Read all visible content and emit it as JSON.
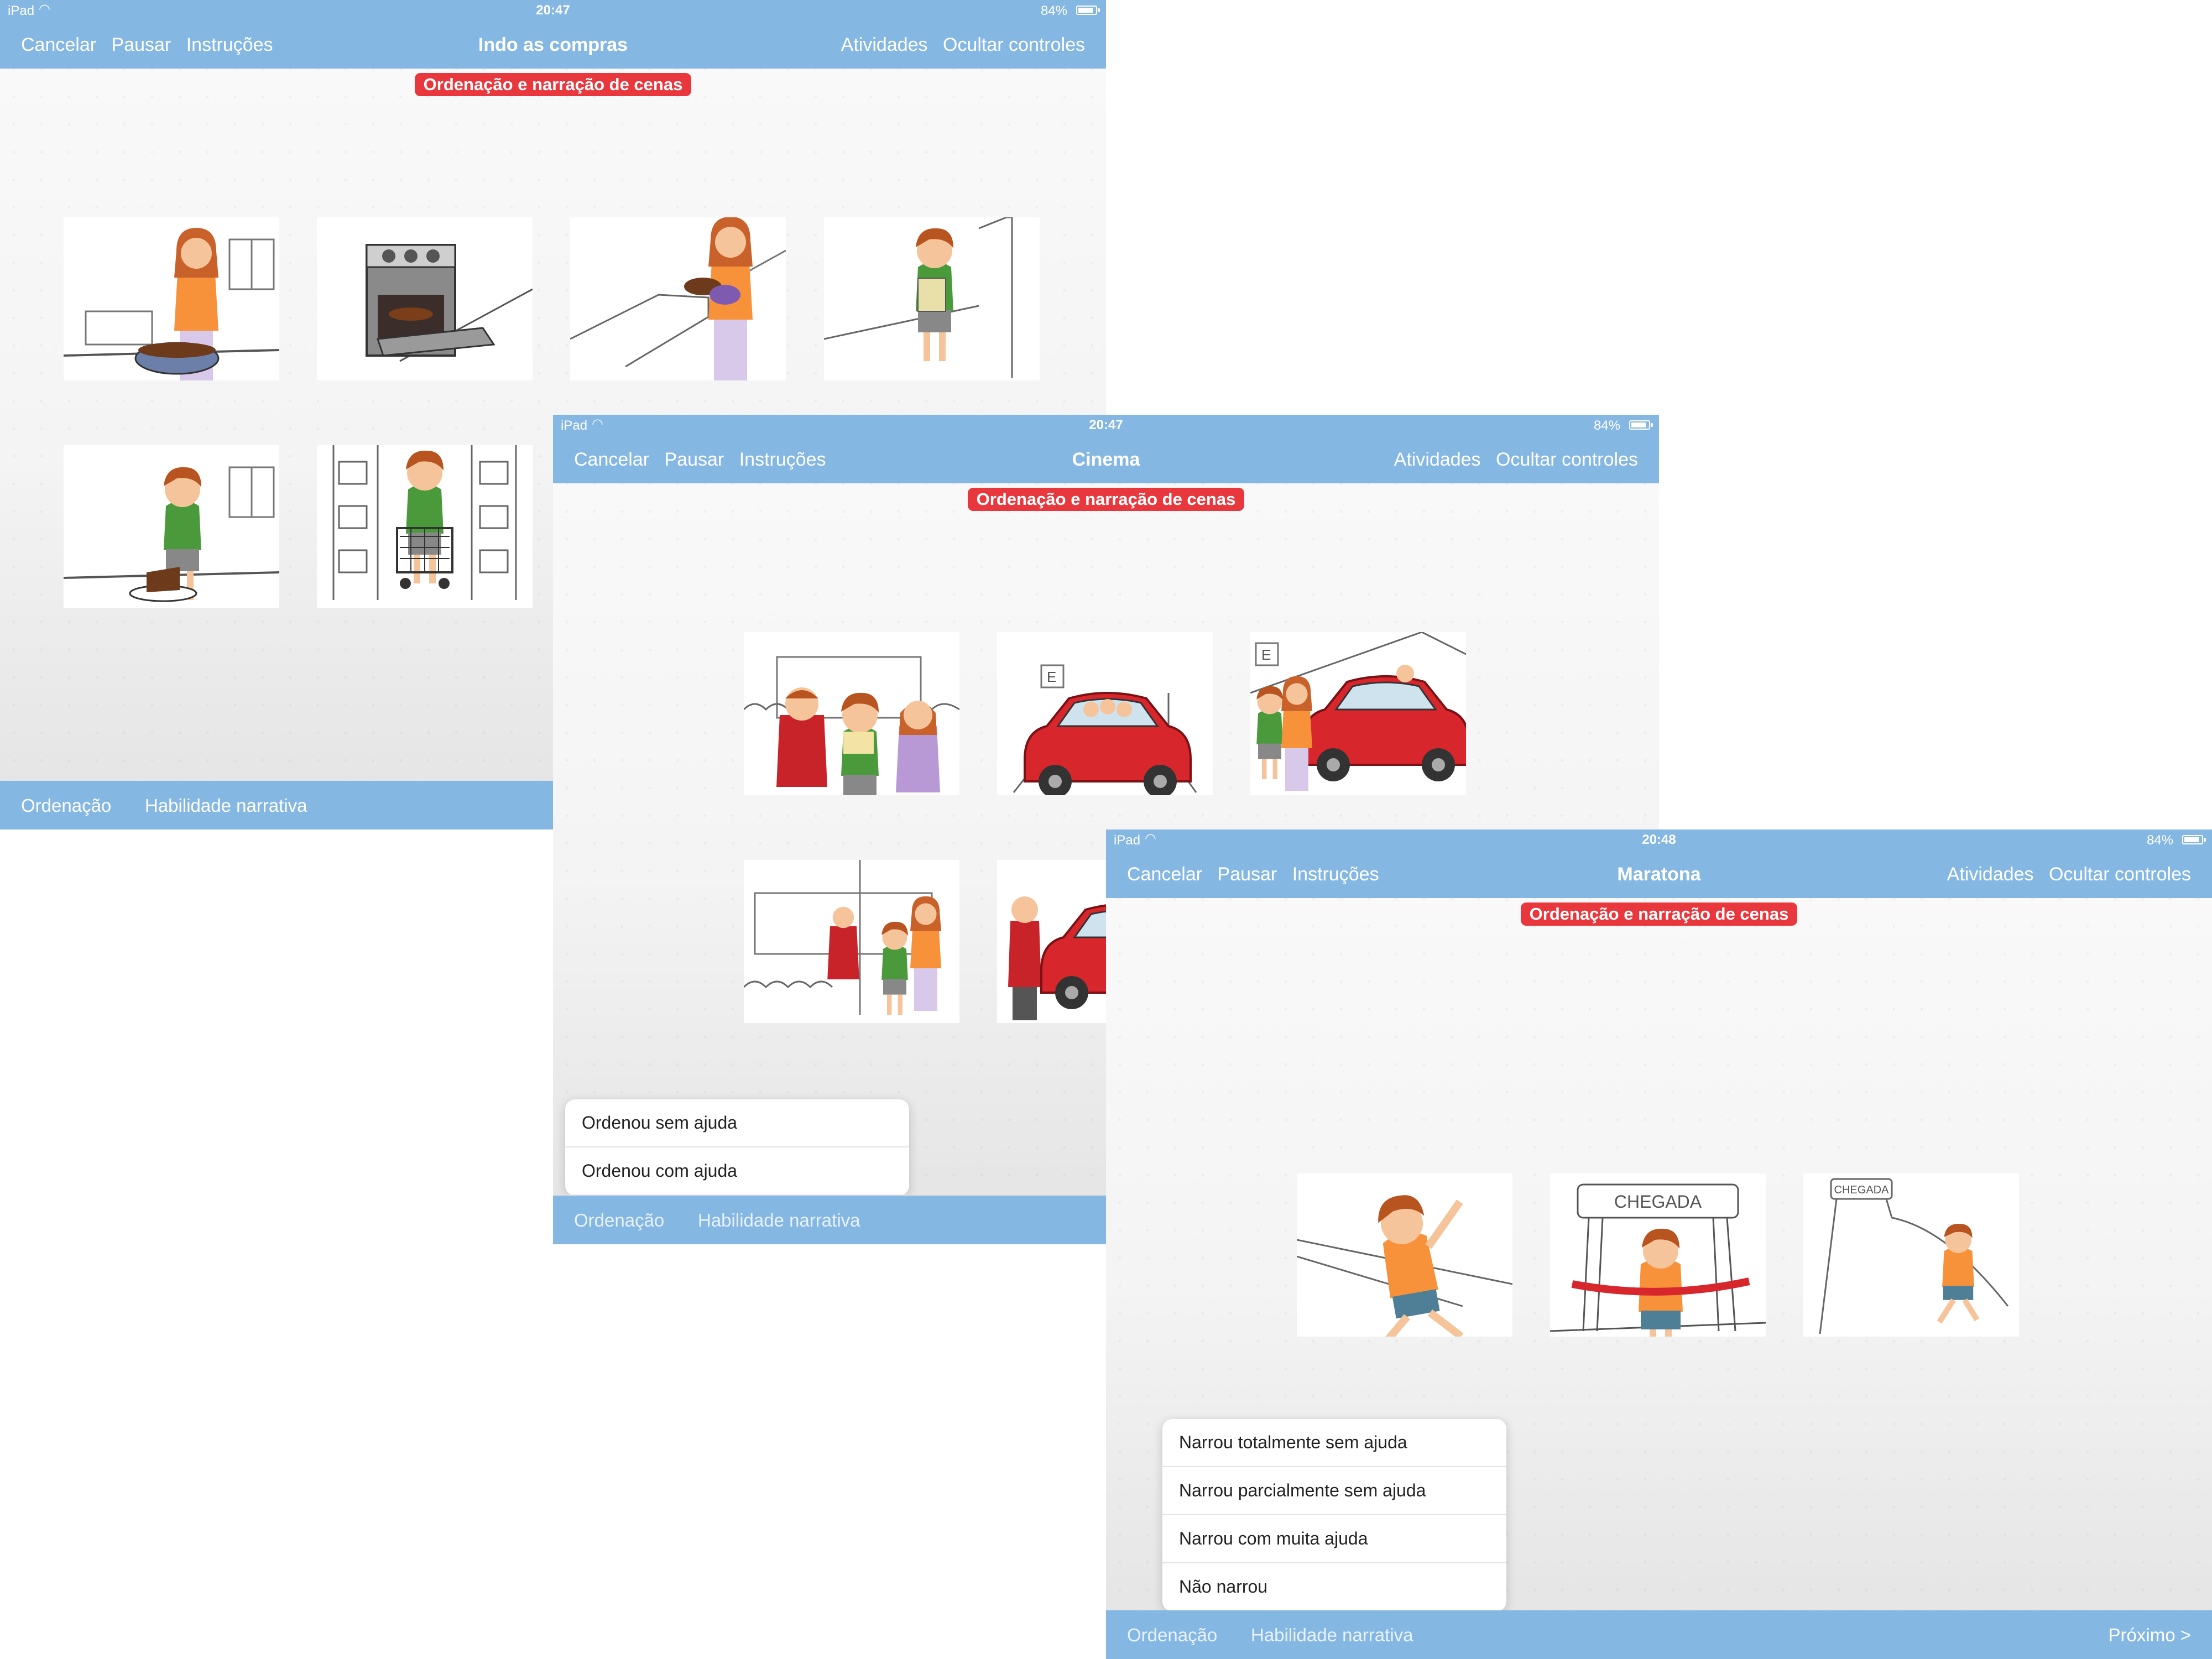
{
  "screens": [
    {
      "status": {
        "device": "iPad",
        "time": "20:47",
        "battery": "84%"
      },
      "toolbar": {
        "cancel": "Cancelar",
        "pause": "Pausar",
        "instructions": "Instruções",
        "title": "Indo as compras",
        "activities": "Atividades",
        "hide_controls": "Ocultar controles"
      },
      "badge": "Ordenação e narração de cenas",
      "scenes": [
        "woman-mixing-batter",
        "cake-in-oven",
        "woman-holding-cake",
        "boy-with-shopping-bag",
        "boy-eating-cake",
        "boy-with-shopping-cart"
      ],
      "tabs": {
        "ordering": "Ordenação",
        "narrative": "Habilidade narrativa"
      }
    },
    {
      "status": {
        "device": "iPad",
        "time": "20:47",
        "battery": "84%"
      },
      "toolbar": {
        "cancel": "Cancelar",
        "pause": "Pausar",
        "instructions": "Instruções",
        "title": "Cinema",
        "activities": "Atividades",
        "hide_controls": "Ocultar controles"
      },
      "badge": "Ordenação e narração de cenas",
      "scenes": [
        "family-in-cinema-seats",
        "family-driving-car",
        "family-arriving-at-car",
        "family-leaving-cinema",
        "man-at-car-door"
      ],
      "popover": {
        "options": [
          "Ordenou sem ajuda",
          "Ordenou com ajuda"
        ]
      },
      "tabs": {
        "ordering": "Ordenação",
        "narrative": "Habilidade narrativa"
      }
    },
    {
      "status": {
        "device": "iPad",
        "time": "20:48",
        "battery": "84%"
      },
      "toolbar": {
        "cancel": "Cancelar",
        "pause": "Pausar",
        "instructions": "Instruções",
        "title": "Maratona",
        "activities": "Atividades",
        "hide_controls": "Ocultar controles"
      },
      "badge": "Ordenação e narração de cenas",
      "scenes": [
        "boy-running-waving",
        "boy-crossing-finish-line",
        "boy-running-toward-finish"
      ],
      "scene_text": {
        "finish_big": "CHEGADA",
        "finish_small": "CHEGADA"
      },
      "popover": {
        "options": [
          "Narrou totalmente sem ajuda",
          "Narrou parcialmente sem ajuda",
          "Narrou com muita ajuda",
          "Não narrou"
        ]
      },
      "tabs": {
        "ordering": "Ordenação",
        "narrative": "Habilidade narrativa"
      },
      "next": "Próximo >"
    }
  ],
  "colors": {
    "bar_blue": "#85b7e3",
    "badge_red": "#e8383d",
    "shirt_orange": "#f7923a",
    "shirt_green": "#4a9a3c",
    "car_red": "#d8262d"
  }
}
